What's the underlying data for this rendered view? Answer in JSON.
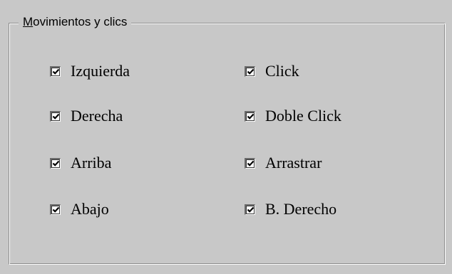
{
  "group": {
    "legend_first": "M",
    "legend_rest": "ovimientos y clics"
  },
  "left_column": [
    {
      "label": "Izquierda",
      "checked": true
    },
    {
      "label": "Derecha",
      "checked": true
    },
    {
      "label": "Arriba",
      "checked": true
    },
    {
      "label": "Abajo",
      "checked": true
    }
  ],
  "right_column": [
    {
      "label": "Click",
      "checked": true
    },
    {
      "label": "Doble Click",
      "checked": true
    },
    {
      "label": "Arrastrar",
      "checked": true
    },
    {
      "label": "B. Derecho",
      "checked": true
    }
  ],
  "colors": {
    "background": "#c8c8c8",
    "checkbox_fill": "#ffffff",
    "check_mark": "#000000"
  }
}
